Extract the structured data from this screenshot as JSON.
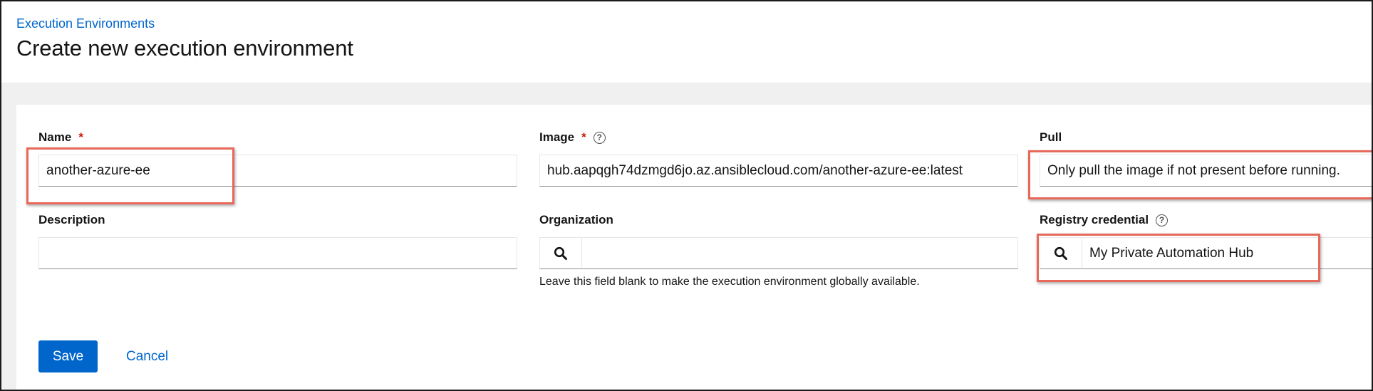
{
  "breadcrumb": "Execution Environments",
  "page_title": "Create new execution environment",
  "form": {
    "name": {
      "label": "Name",
      "required": "*",
      "value": "another-azure-ee"
    },
    "image": {
      "label": "Image",
      "required": "*",
      "value": "hub.aapqgh74dzmgd6jo.az.ansiblecloud.com/another-azure-ee:latest"
    },
    "pull": {
      "label": "Pull",
      "value": "Only pull the image if not present before running."
    },
    "description": {
      "label": "Description",
      "value": ""
    },
    "organization": {
      "label": "Organization",
      "value": "",
      "hint": "Leave this field blank to make the execution environment globally available."
    },
    "registry_credential": {
      "label": "Registry credential",
      "value": "My Private Automation Hub"
    }
  },
  "actions": {
    "save": "Save",
    "cancel": "Cancel"
  },
  "help_glyph": "?",
  "icons": {
    "help": "question-circle-icon",
    "search": "search-icon"
  },
  "colors": {
    "link": "#0066cc",
    "primary": "#0066cc",
    "required": "#c9190b",
    "highlight": "#e8685a"
  }
}
